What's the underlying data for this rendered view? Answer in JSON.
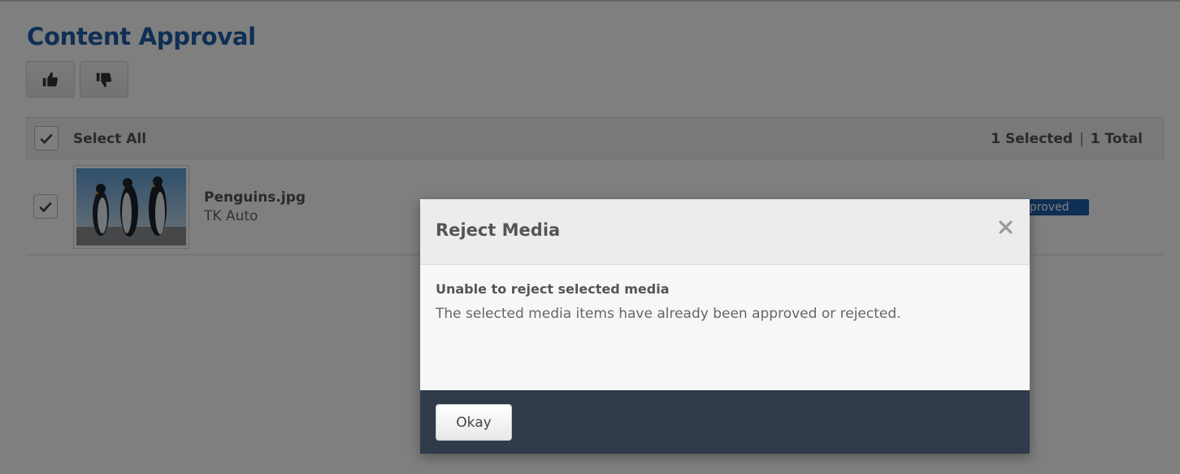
{
  "page": {
    "title": "Content Approval",
    "toolbar": {
      "approve_icon": "thumbs-up-icon",
      "reject_icon": "thumbs-down-icon"
    }
  },
  "list": {
    "select_all_label": "Select All",
    "select_all_checked": true,
    "selected_count": "1 Selected",
    "separator": "|",
    "total_count": "1 Total",
    "items": [
      {
        "checked": true,
        "file_name": "Penguins.jpg",
        "owner": "TK Auto",
        "status": "Approved",
        "status_visible_text": "pproved"
      }
    ]
  },
  "modal": {
    "title": "Reject Media",
    "close_icon": "close-icon",
    "heading": "Unable to reject selected media",
    "message": "The selected media items have already been approved or rejected.",
    "okay_label": "Okay"
  },
  "colors": {
    "title_blue": "#1e5fa8",
    "badge_blue": "#1e5fa8",
    "footer_navy": "#2f3a4b",
    "backdrop": "rgba(0,0,0,0.5)"
  }
}
